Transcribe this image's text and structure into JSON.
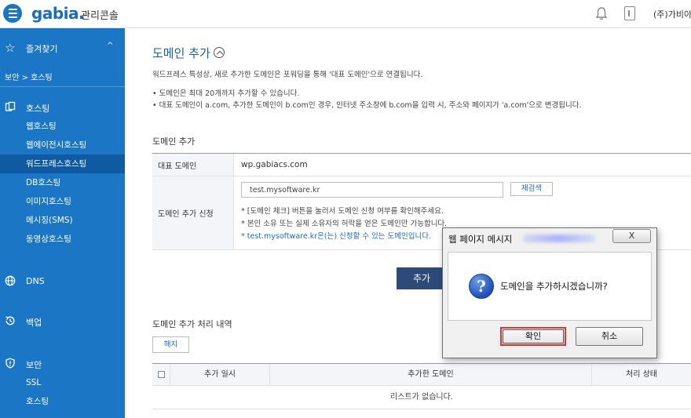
{
  "header": {
    "logo": "gabia.",
    "console_label": "관리콘솔",
    "company": "(주)가비아"
  },
  "sidebar": {
    "favorites_label": "즐겨찾기",
    "breadcrumb": "보안 > 호스팅",
    "groups": {
      "hosting": "호스팅",
      "dns": "DNS",
      "backup": "백업",
      "security": "보안"
    },
    "hosting_items": [
      "웹호스팅",
      "웹에이전시호스팅",
      "워드프레스호스팅",
      "DB호스팅",
      "이미지호스팅",
      "메시징(SMS)",
      "동영상호스팅"
    ],
    "security_items": [
      "SSL",
      "호스팅"
    ]
  },
  "main": {
    "title": "도메인 추가",
    "description": "워드프레스 특성상, 새로 추가한 도메인은 포워딩을 통해 '대표 도메인'으로 연결됩니다.",
    "bullets": [
      "•  도메인은 최대 20개까지 추가할 수 있습니다.",
      "•  대표 도메인이 a.com, 추가한 도메인이 b.com인 경우, 인터넷 주소창에 b.com을 입력 시, 주소와 페이지가 'a.com'으로 변경됩니다."
    ],
    "section_add": "도메인 추가",
    "primary_domain_label": "대표 도메인",
    "primary_domain_value": "wp.gabiacs.com",
    "add_request_label": "도메인 추가 신청",
    "domain_input_value": "test.mysoftware.kr",
    "recheck_label": "재검색",
    "notes": [
      "* [도메인 체크] 버튼을 눌러서 도메인 신청 여부를 확인해주세요.",
      "* 본인 소유 또는 실제 소유자의 허락을 얻은 도메인만 가능합니다.",
      "* test.mysoftware.kr은(는) 신청할 수 있는 도메인입니다."
    ],
    "add_button": "추가",
    "section_history": "도메인 추가 처리 내역",
    "release_button": "해지",
    "columns": [
      "추가 일시",
      "추가한 도메인",
      "처리 상태"
    ],
    "empty_message": "리스트가 없습니다."
  },
  "dialog": {
    "title": "웹 페이지 메시지",
    "close": "X",
    "message": "도메인을 추가하시겠습니까?",
    "ok": "확인",
    "cancel": "취소"
  }
}
